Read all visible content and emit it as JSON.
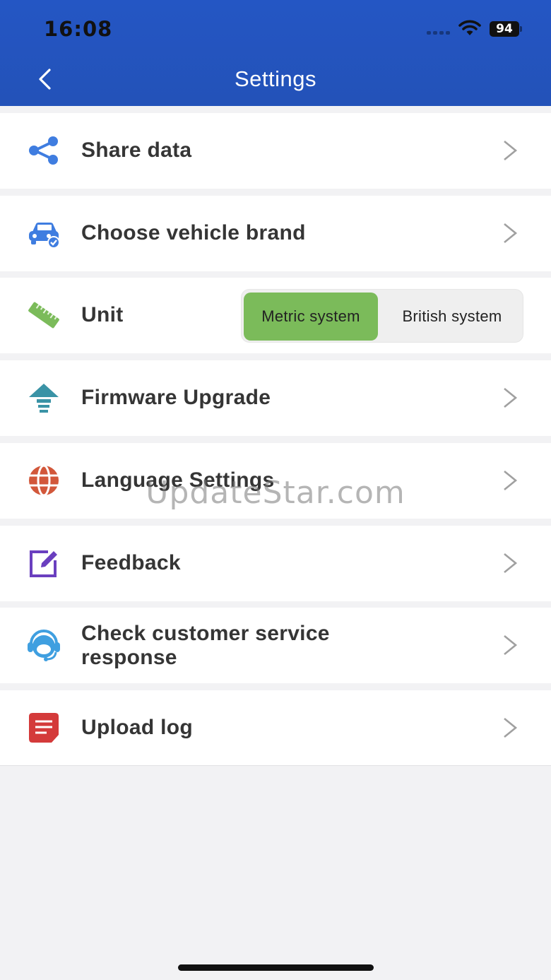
{
  "status_bar": {
    "time": "16:08",
    "battery": "94"
  },
  "nav": {
    "title": "Settings",
    "back_icon": "chevron-left-icon"
  },
  "items": [
    {
      "label": "Share data",
      "icon": "share-icon",
      "color": "#3f7de0"
    },
    {
      "label": "Choose vehicle brand",
      "icon": "car-icon",
      "color": "#3f7de0"
    },
    {
      "label": "Unit",
      "icon": "ruler-icon",
      "color": "#7bbb5a"
    },
    {
      "label": "Firmware Upgrade",
      "icon": "upgrade-arrow-icon",
      "color": "#3a93a6"
    },
    {
      "label": "Language Settings",
      "icon": "globe-icon",
      "color": "#d2573a"
    },
    {
      "label": "Feedback",
      "icon": "edit-icon",
      "color": "#6a3fbf"
    },
    {
      "label": "Check customer service response",
      "label_line1": "Check customer service",
      "label_line2": "response",
      "icon": "headset-icon",
      "color": "#3f9fe0"
    },
    {
      "label": "Upload log",
      "icon": "document-icon",
      "color": "#d43a3a"
    }
  ],
  "unit_toggle": {
    "options": [
      "Metric system",
      "British system"
    ],
    "selected": "Metric system",
    "selected_color": "#7bbb5a"
  },
  "watermark": "UpdateStar.com",
  "colors": {
    "header": "#2456c4",
    "background": "#f2f2f4"
  }
}
